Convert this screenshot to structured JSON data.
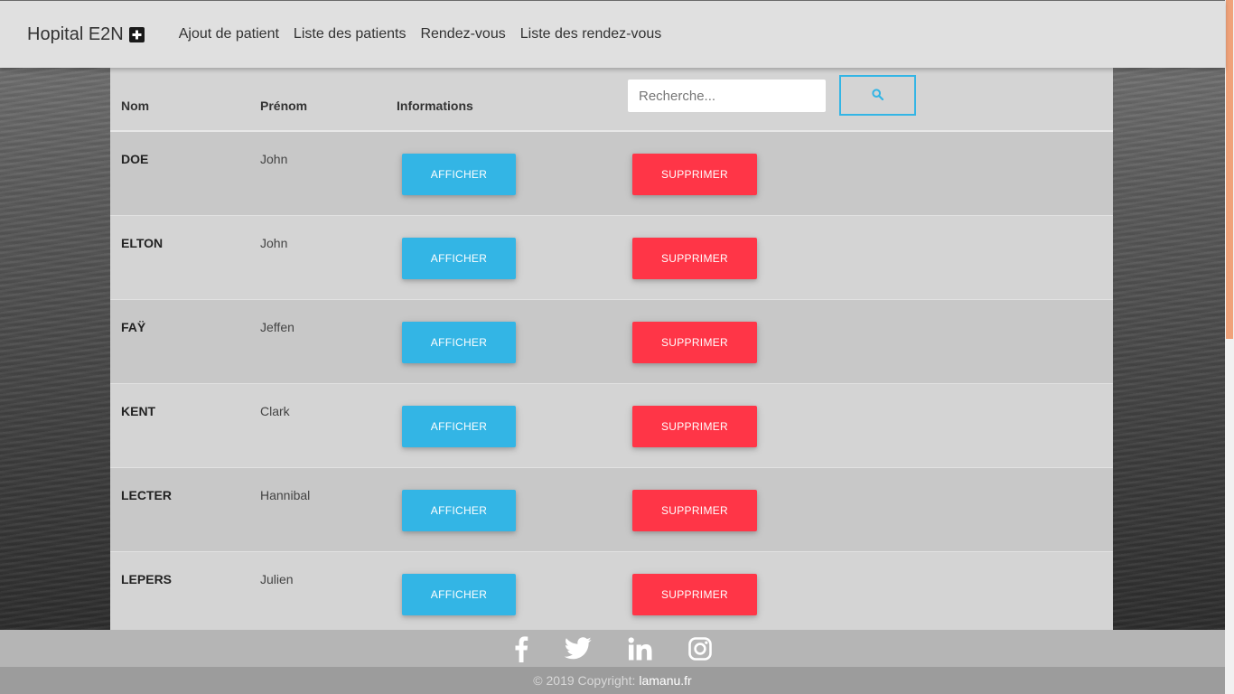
{
  "navbar": {
    "brand": "Hopital E2N",
    "brand_icon": "plus-square-icon",
    "links": [
      "Ajout de patient",
      "Liste des patients",
      "Rendez-vous",
      "Liste des rendez-vous"
    ]
  },
  "table": {
    "headers": {
      "nom": "Nom",
      "prenom": "Prénom",
      "informations": "Informations"
    },
    "search": {
      "placeholder": "Recherche...",
      "value": "",
      "icon": "search-icon"
    },
    "show_label": "AFFICHER",
    "delete_label": "SUPPRIMER",
    "rows": [
      {
        "nom": "DOE",
        "prenom": "John"
      },
      {
        "nom": "ELTON",
        "prenom": "John"
      },
      {
        "nom": "FAŸ",
        "prenom": "Jeffen"
      },
      {
        "nom": "KENT",
        "prenom": "Clark"
      },
      {
        "nom": "LECTER",
        "prenom": "Hannibal"
      },
      {
        "nom": "LEPERS",
        "prenom": "Julien"
      }
    ]
  },
  "footer": {
    "social_icons": [
      "facebook-icon",
      "twitter-icon",
      "linkedin-icon",
      "instagram-icon"
    ],
    "copyright": "© 2019 Copyright:",
    "link": "lamanu.fr"
  },
  "colors": {
    "primary": "#33b5e5",
    "danger": "#ff3547",
    "navbar_bg": "#e0e0e0",
    "scrollbar_thumb": "#f0a27a"
  }
}
